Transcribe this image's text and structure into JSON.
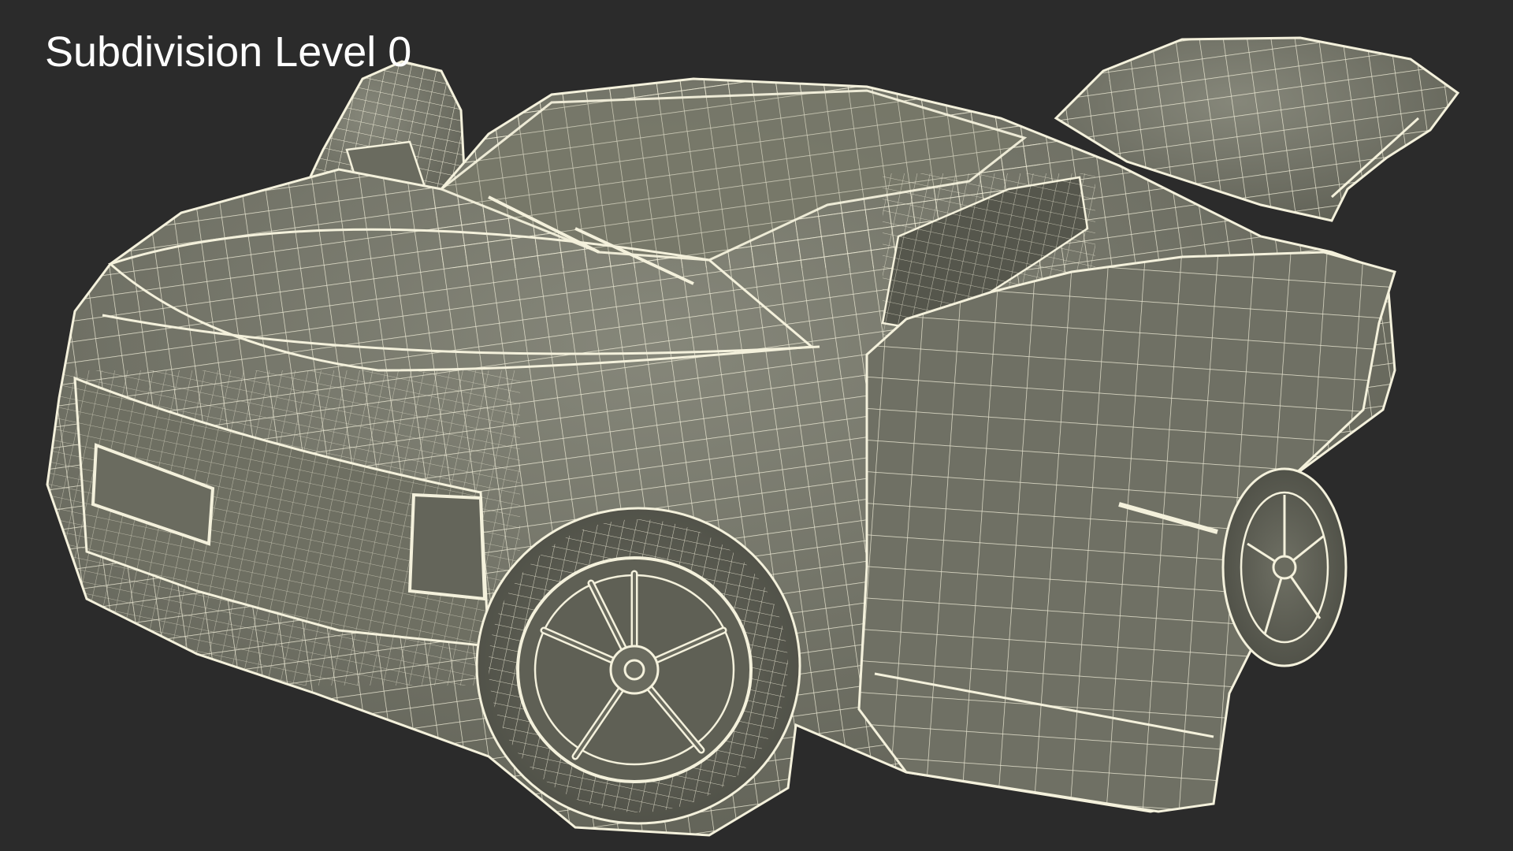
{
  "overlay": {
    "title": "Subdivision Level 0"
  },
  "render": {
    "subject": "car-wireframe-icon",
    "background_color": "#2b2b2b",
    "surface_color": "#76776a",
    "wire_color": "#f4f1dc"
  }
}
